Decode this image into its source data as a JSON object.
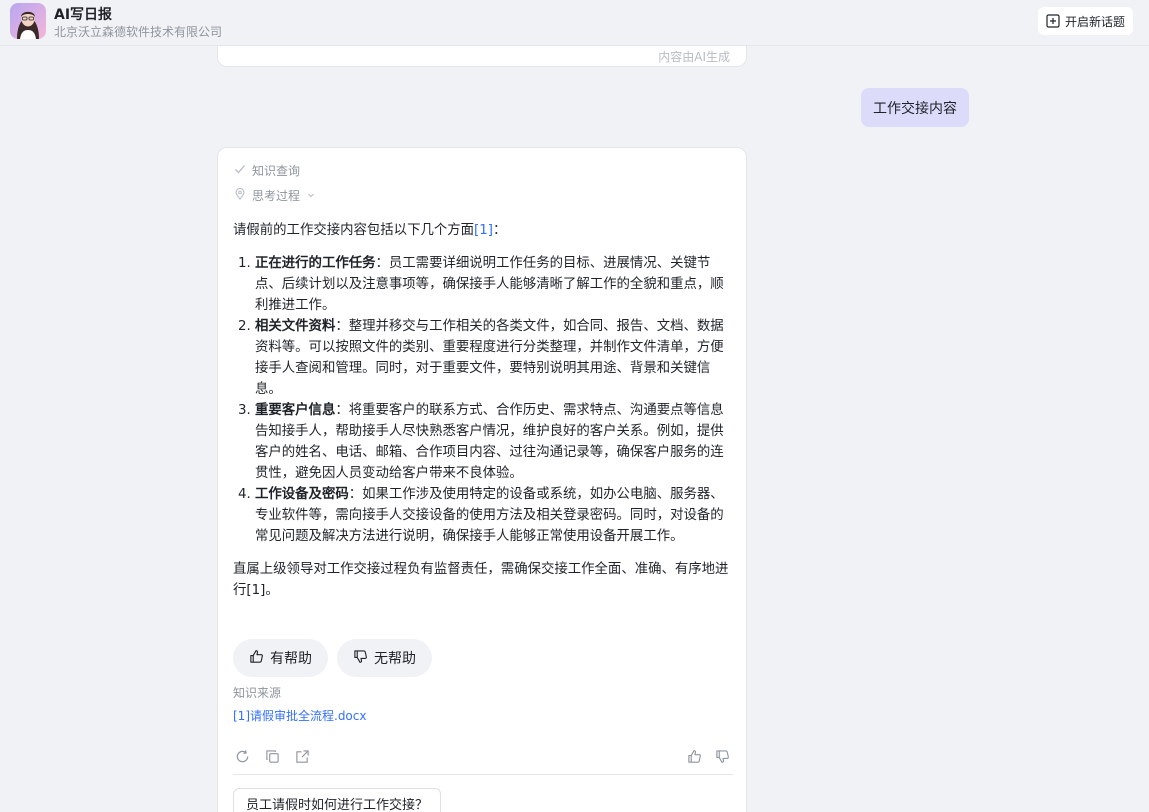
{
  "header": {
    "app_title": "AI写日报",
    "app_subtitle": "北京沃立森德软件技术有限公司",
    "new_topic_label": "开启新话题",
    "avatar_icon": "assistant-avatar"
  },
  "prev_card": {
    "ai_generated_note": "内容由AI生成"
  },
  "user_message": "工作交接内容",
  "answer": {
    "steps": [
      {
        "icon": "check-icon",
        "label": "知识查询"
      },
      {
        "icon": "location-pin-icon",
        "label": "思考过程"
      }
    ],
    "intro_text": "请假前的工作交接内容包括以下几个方面",
    "intro_cite": "[1]",
    "intro_end": "：",
    "items": [
      {
        "title": "正在进行的工作任务",
        "text": "：员工需要详细说明工作任务的目标、进展情况、关键节点、后续计划以及注意事项等，确保接手人能够清晰了解工作的全貌和重点，顺利推进工作。"
      },
      {
        "title": "相关文件资料",
        "text": "：整理并移交与工作相关的各类文件，如合同、报告、文档、数据资料等。可以按照文件的类别、重要程度进行分类整理，并制作文件清单，方便接手人查阅和管理。同时，对于重要文件，要特别说明其用途、背景和关键信息。"
      },
      {
        "title": "重要客户信息",
        "text": "：将重要客户的联系方式、合作历史、需求特点、沟通要点等信息告知接手人，帮助接手人尽快熟悉客户情况，维护良好的客户关系。例如，提供客户的姓名、电话、邮箱、合作项目内容、过往沟通记录等，确保客户服务的连贯性，避免因人员变动给客户带来不良体验。"
      },
      {
        "title": "工作设备及密码",
        "text": "：如果工作涉及使用特定的设备或系统，如办公电脑、服务器、专业软件等，需向接手人交接设备的使用方法及相关登录密码。同时，对设备的常见问题及解决方法进行说明，确保接手人能够正常使用设备开展工作。"
      }
    ],
    "outro_text": "直属上级领导对工作交接过程负有监督责任，需确保交接工作全面、准确、有序地进行",
    "outro_cite": "[1]",
    "outro_end": "。",
    "helpful_label": "有帮助",
    "not_helpful_label": "无帮助",
    "source_label": "知识来源",
    "source_link": "[1]请假审批全流程.docx",
    "suggestion": "员工请假时如何进行工作交接？"
  },
  "colors": {
    "background": "#f1f2f5",
    "user_bubble": "#dcdbfa",
    "link": "#3370ff"
  }
}
